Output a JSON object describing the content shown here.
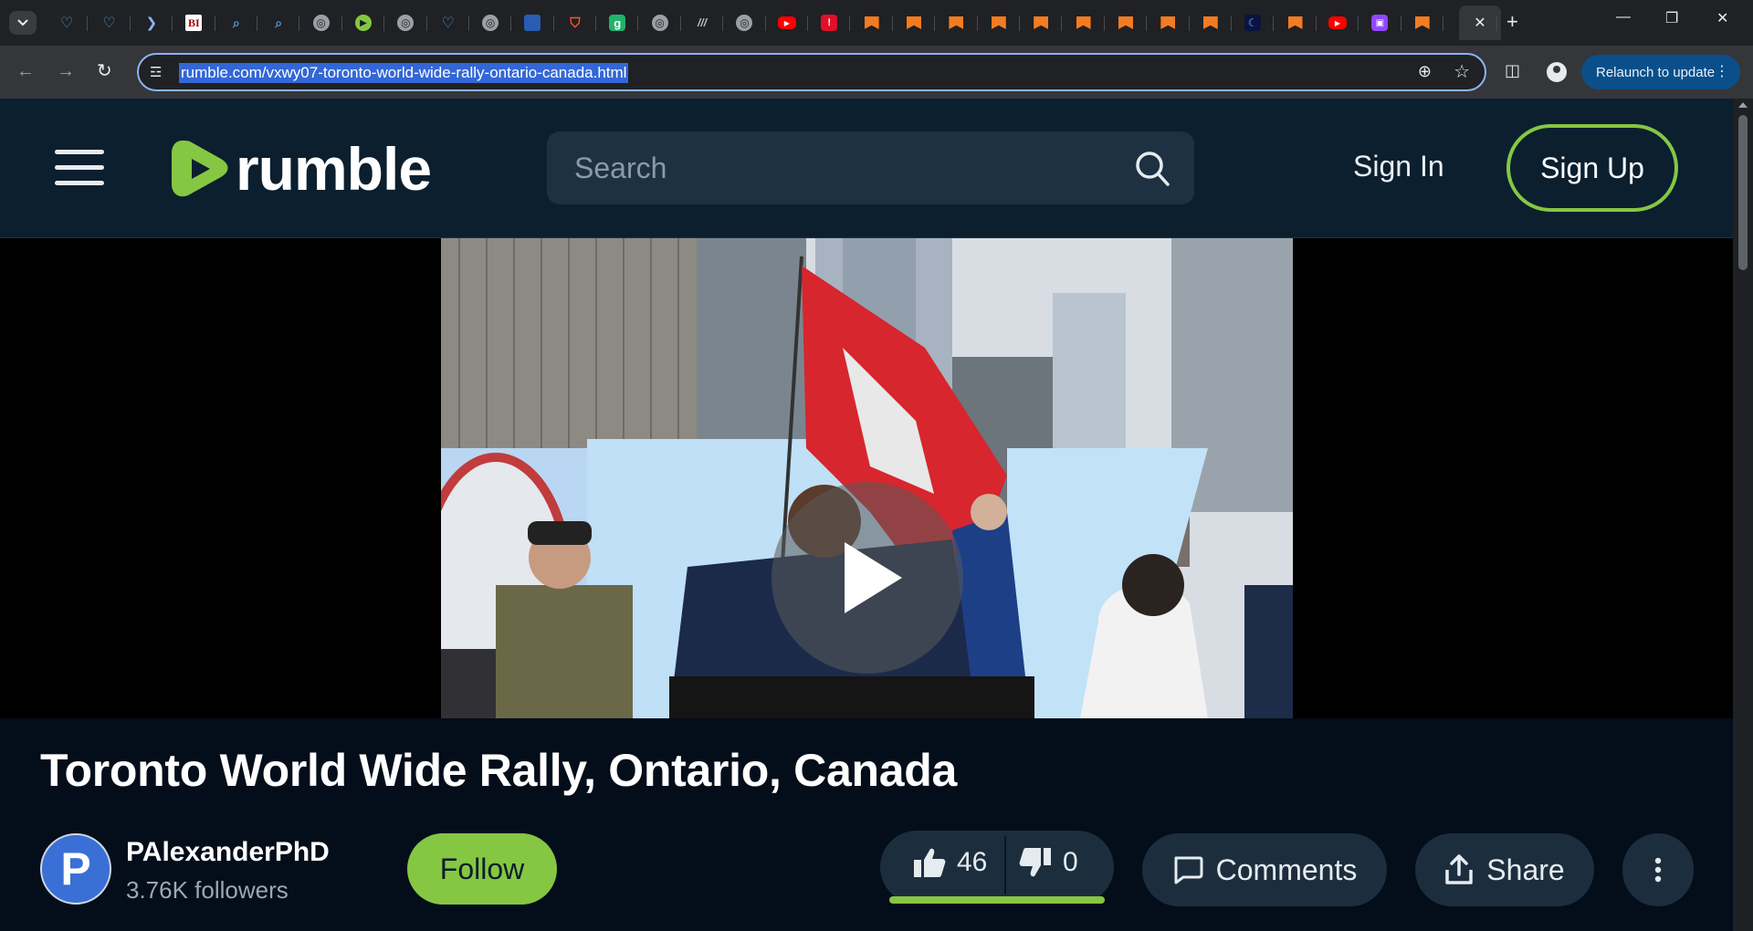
{
  "browser": {
    "tab_search_icon": "chevron-down-icon",
    "tabs": [
      {
        "icon": "shield-favicon",
        "type": "shield",
        "glyph": "♡"
      },
      {
        "icon": "shield-favicon",
        "type": "shield",
        "glyph": "♡"
      },
      {
        "icon": "arrow-favicon",
        "type": "arrow",
        "glyph": "❯"
      },
      {
        "icon": "bi-favicon",
        "type": "bi",
        "glyph": "BI"
      },
      {
        "icon": "search-favicon",
        "type": "mag",
        "glyph": "⌕"
      },
      {
        "icon": "search-favicon",
        "type": "mag",
        "glyph": "⌕"
      },
      {
        "icon": "globe-favicon",
        "type": "globe",
        "glyph": "◎"
      },
      {
        "icon": "rumble-favicon",
        "type": "rumble",
        "glyph": "▶"
      },
      {
        "icon": "globe-favicon",
        "type": "globe",
        "glyph": "◎"
      },
      {
        "icon": "shield-favicon",
        "type": "shield",
        "glyph": "♡"
      },
      {
        "icon": "globe-favicon",
        "type": "globe",
        "glyph": "◎"
      },
      {
        "icon": "cube-favicon",
        "type": "cube",
        "glyph": ""
      },
      {
        "icon": "brave-favicon",
        "type": "brave",
        "glyph": "⛉"
      },
      {
        "icon": "g-favicon",
        "type": "g",
        "glyph": "g"
      },
      {
        "icon": "globe-favicon",
        "type": "globe",
        "glyph": "◎"
      },
      {
        "icon": "mm-favicon",
        "type": "mm",
        "glyph": "///"
      },
      {
        "icon": "globe-favicon",
        "type": "globe",
        "glyph": "◎"
      },
      {
        "icon": "youtube-favicon",
        "type": "yt",
        "glyph": "▶"
      },
      {
        "icon": "red-favicon",
        "type": "red",
        "glyph": "!"
      },
      {
        "icon": "bookmark-favicon",
        "type": "bm",
        "glyph": ""
      },
      {
        "icon": "bookmark-favicon",
        "type": "bm",
        "glyph": ""
      },
      {
        "icon": "bookmark-favicon",
        "type": "bm",
        "glyph": ""
      },
      {
        "icon": "bookmark-favicon",
        "type": "bm",
        "glyph": ""
      },
      {
        "icon": "bookmark-favicon",
        "type": "bm",
        "glyph": ""
      },
      {
        "icon": "bookmark-favicon",
        "type": "bm",
        "glyph": ""
      },
      {
        "icon": "bookmark-favicon",
        "type": "bm",
        "glyph": ""
      },
      {
        "icon": "bookmark-favicon",
        "type": "bm",
        "glyph": ""
      },
      {
        "icon": "bookmark-favicon",
        "type": "bm",
        "glyph": ""
      },
      {
        "icon": "firefox-favicon",
        "type": "fire",
        "glyph": "☾"
      },
      {
        "icon": "bookmark-favicon",
        "type": "bm",
        "glyph": ""
      },
      {
        "icon": "youtube-favicon",
        "type": "yt",
        "glyph": "▶"
      },
      {
        "icon": "twitch-favicon",
        "type": "tw",
        "glyph": "▣"
      },
      {
        "icon": "bookmark-favicon",
        "type": "bm",
        "glyph": ""
      }
    ],
    "active_tab_close": "✕",
    "new_tab": "+",
    "minimize": "—",
    "restore": "❐",
    "close": "✕",
    "back": "←",
    "forward": "→",
    "reload": "↻",
    "site_info": "☲",
    "url": "rumble.com/vxwy07-toronto-world-wide-rally-ontario-canada.html",
    "zoom_icon": "⊕",
    "bookmark_star": "☆",
    "side_panel": "◫",
    "relaunch_label": "Relaunch to update",
    "relaunch_menu": "⋮"
  },
  "site": {
    "brand": "rumble",
    "brand_color": "#85c742",
    "search_placeholder": "Search",
    "sign_in": "Sign In",
    "sign_up": "Sign Up"
  },
  "video": {
    "title": "Toronto World Wide Rally, Ontario, Canada",
    "channel_initial": "P",
    "channel_name": "PAlexanderPhD",
    "followers": "3.76K followers",
    "follow_label": "Follow",
    "likes": "46",
    "dislikes": "0",
    "comments_label": "Comments",
    "share_label": "Share"
  }
}
